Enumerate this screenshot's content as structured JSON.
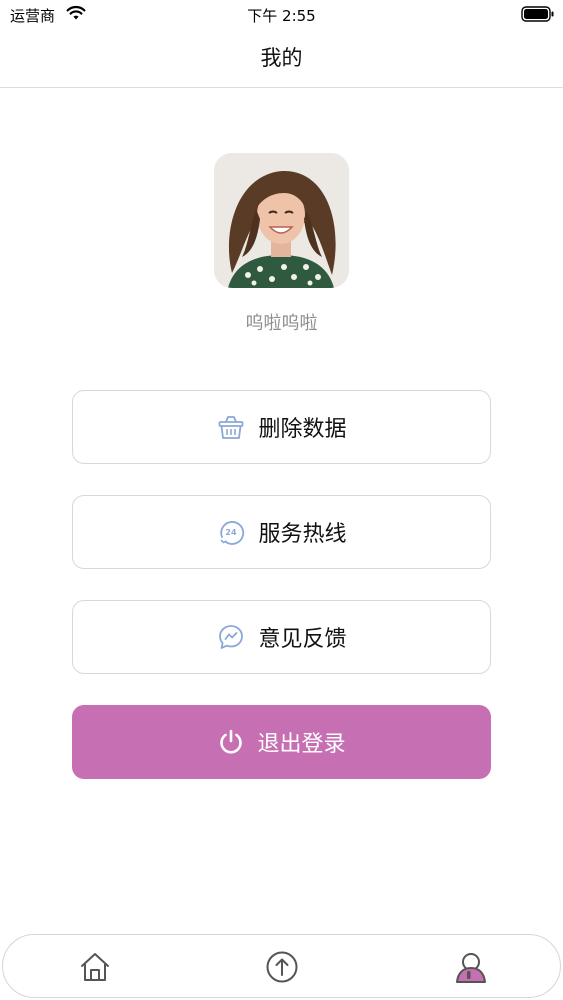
{
  "status_bar": {
    "carrier": "运营商",
    "time": "下午 2:55"
  },
  "nav": {
    "title": "我的"
  },
  "profile": {
    "username": "呜啦呜啦"
  },
  "menu": {
    "items": [
      {
        "label": "删除数据",
        "icon": "basket-icon"
      },
      {
        "label": "服务热线",
        "icon": "hotline-24-icon"
      },
      {
        "label": "意见反馈",
        "icon": "feedback-chat-icon"
      }
    ],
    "logout_label": "退出登录"
  },
  "tab_bar": {
    "tabs": [
      {
        "icon": "home-icon",
        "active": false
      },
      {
        "icon": "upload-circle-icon",
        "active": false
      },
      {
        "icon": "profile-icon",
        "active": true
      }
    ]
  },
  "colors": {
    "accent": "#c76fb3",
    "icon_blue": "#8aa8d8",
    "muted_text": "#8e8e8e",
    "border": "#d8d8d8"
  }
}
